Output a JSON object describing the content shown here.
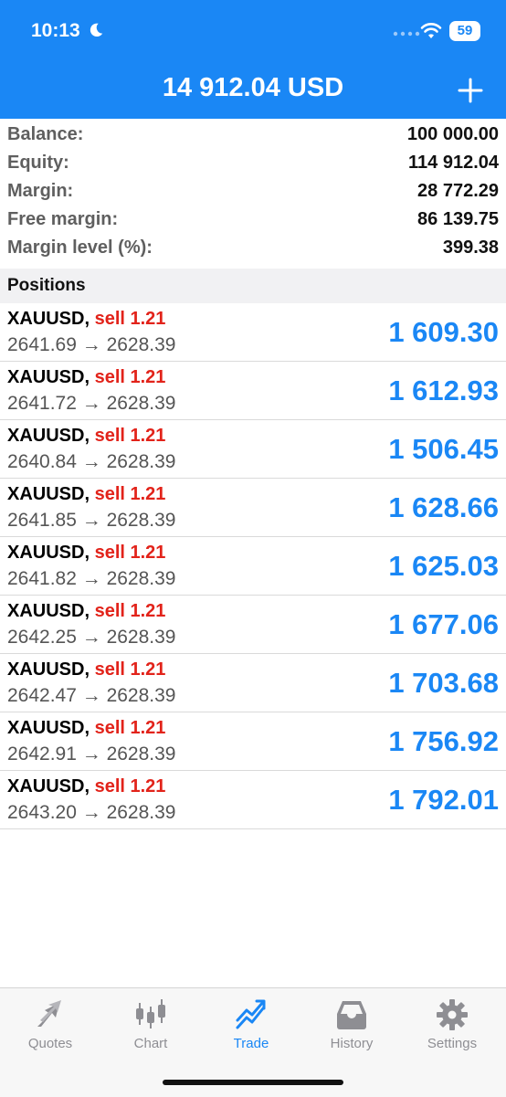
{
  "status_bar": {
    "time": "10:13",
    "battery": "59"
  },
  "header": {
    "title": "14 912.04 USD"
  },
  "summary": [
    {
      "label": "Balance:",
      "value": "100 000.00"
    },
    {
      "label": "Equity:",
      "value": "114 912.04"
    },
    {
      "label": "Margin:",
      "value": "28 772.29"
    },
    {
      "label": "Free margin:",
      "value": "86 139.75"
    },
    {
      "label": "Margin level (%):",
      "value": "399.38"
    }
  ],
  "section": {
    "title": "Positions"
  },
  "positions": [
    {
      "symbol": "XAUUSD,",
      "side": "sell 1.21",
      "prices": "2641.69 → 2628.39",
      "profit": "1 609.30"
    },
    {
      "symbol": "XAUUSD,",
      "side": "sell 1.21",
      "prices": "2641.72 → 2628.39",
      "profit": "1 612.93"
    },
    {
      "symbol": "XAUUSD,",
      "side": "sell 1.21",
      "prices": "2640.84 → 2628.39",
      "profit": "1 506.45"
    },
    {
      "symbol": "XAUUSD,",
      "side": "sell 1.21",
      "prices": "2641.85 → 2628.39",
      "profit": "1 628.66"
    },
    {
      "symbol": "XAUUSD,",
      "side": "sell 1.21",
      "prices": "2641.82 → 2628.39",
      "profit": "1 625.03"
    },
    {
      "symbol": "XAUUSD,",
      "side": "sell 1.21",
      "prices": "2642.25 → 2628.39",
      "profit": "1 677.06"
    },
    {
      "symbol": "XAUUSD,",
      "side": "sell 1.21",
      "prices": "2642.47 → 2628.39",
      "profit": "1 703.68"
    },
    {
      "symbol": "XAUUSD,",
      "side": "sell 1.21",
      "prices": "2642.91 → 2628.39",
      "profit": "1 756.92"
    },
    {
      "symbol": "XAUUSD,",
      "side": "sell 1.21",
      "prices": "2643.20 → 2628.39",
      "profit": "1 792.01"
    }
  ],
  "tabs": [
    {
      "label": "Quotes",
      "icon": "quotes-icon"
    },
    {
      "label": "Chart",
      "icon": "chart-icon"
    },
    {
      "label": "Trade",
      "icon": "trade-icon",
      "active": true
    },
    {
      "label": "History",
      "icon": "history-icon"
    },
    {
      "label": "Settings",
      "icon": "settings-icon"
    }
  ],
  "colors": {
    "accent": "#1a87f5",
    "sell": "#e2231a",
    "tab_inactive": "#8e8e93"
  }
}
